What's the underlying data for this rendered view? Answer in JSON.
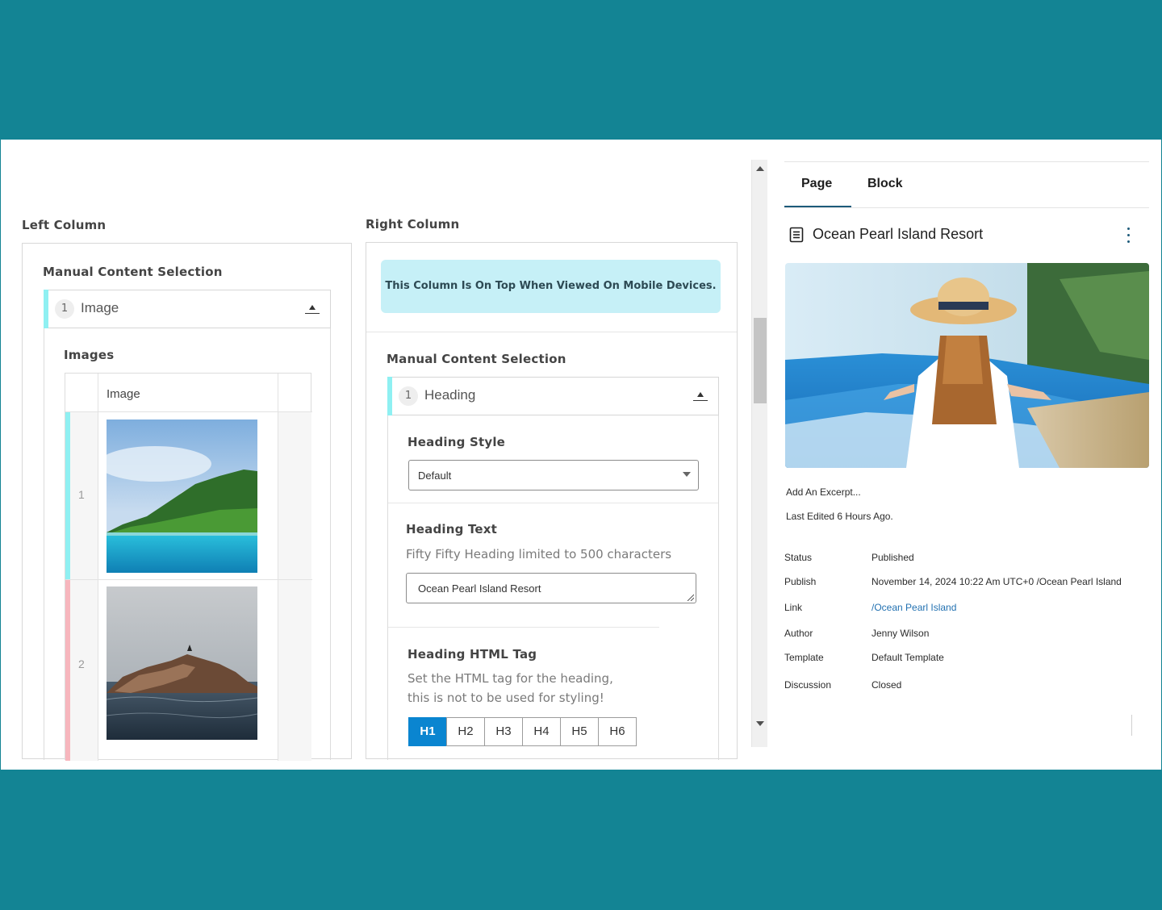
{
  "left_column": {
    "label": "Left Column",
    "section_title": "Manual Content Selection",
    "accordion": {
      "number": "1",
      "label": "Image"
    },
    "images_title": "Images",
    "table_header": "Image",
    "rows": [
      {
        "index": "1",
        "accent": "#8ff0f2",
        "alt": "tropical-island-image"
      },
      {
        "index": "2",
        "accent": "#f7b6bd",
        "alt": "rock-in-sea-image"
      }
    ]
  },
  "right_column": {
    "label": "Right Column",
    "info_text": "This Column Is On Top When Viewed On Mobile Devices.",
    "section_title": "Manual Content Selection",
    "accordion": {
      "number": "1",
      "label": "Heading"
    },
    "heading_style": {
      "title": "Heading Style",
      "value": "Default"
    },
    "heading_text": {
      "title": "Heading Text",
      "help": "Fifty Fifty Heading limited to 500 characters",
      "value": "Ocean Pearl Island Resort"
    },
    "heading_tag": {
      "title": "Heading HTML Tag",
      "help_line1": "Set the HTML tag for the heading,",
      "help_line2": "this is not to be used for styling!",
      "options": [
        "H1",
        "H2",
        "H3",
        "H4",
        "H5",
        "H6"
      ],
      "selected": "H1"
    }
  },
  "sidebar": {
    "tabs": [
      "Page",
      "Block"
    ],
    "active_tab": "Page",
    "doc_title": "Ocean Pearl Island Resort",
    "excerpt": "Add An Excerpt...",
    "last_edited": "Last Edited 6 Hours Ago.",
    "meta": [
      {
        "label": "Status",
        "value": "Published"
      },
      {
        "label": "Publish",
        "value": "November 14, 2024 10:22 Am UTC+0 /Ocean Pearl Island"
      },
      {
        "label": "Link",
        "value": "/Ocean Pearl Island"
      },
      {
        "label": "Author",
        "value": "Jenny Wilson"
      },
      {
        "label": "Template",
        "value": "Default Template"
      },
      {
        "label": "Discussion",
        "value": "Closed"
      }
    ]
  },
  "colors": {
    "frame": "#138494",
    "accent_cyan": "#8ff0f2",
    "accent_pink": "#f7b6bd",
    "button_active": "#0a85d0",
    "info_bg": "#c6f0f7",
    "tab_underline": "#1d5b7a",
    "link": "#2271b1"
  }
}
